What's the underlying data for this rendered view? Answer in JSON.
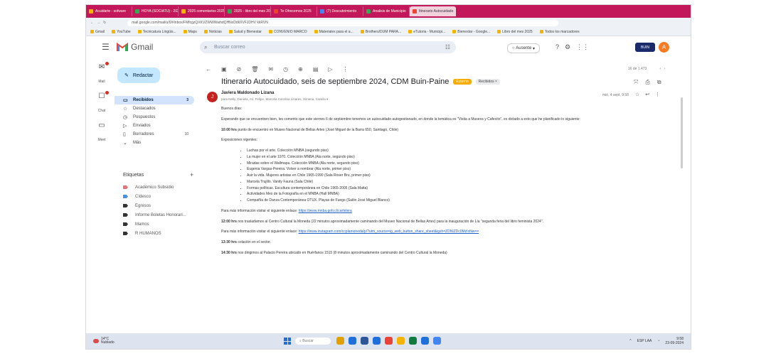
{
  "browser": {
    "tabs": [
      {
        "label": "Acuidarte - sofware",
        "color": "#f5b400"
      },
      {
        "label": "HOYA (SOCIATU) - 202",
        "color": "#34a853"
      },
      {
        "label": "2025 comentarios 2025",
        "color": "#f5b400"
      },
      {
        "label": "2025 - libro del mes 202",
        "color": "#34a853"
      },
      {
        "label": "Te Ofrecemos 2025",
        "color": "#ea4335"
      },
      {
        "label": "(7) Descubrimiento",
        "color": "#4285f4"
      },
      {
        "label": "Analisis de Municipio",
        "color": "#34a853"
      },
      {
        "label": "Itinerario Autocuidado",
        "color": "#ea4335",
        "active": true
      }
    ],
    "url": "mail.google.com/mail/u/0/#inbox/FMfcgzQXKVZWWWwhdQHNxDdkXVFJDHV kkRVN",
    "bookmarks": [
      "Gmail",
      "YouTube",
      "Tecnicatura Lingüis...",
      "Maps",
      "Noticias",
      "Salud y Bienestar",
      "CONVENIO MARCO",
      "Materiales para el a...",
      "Brothers/DUM PARA...",
      "eTutoria - Municipi...",
      "Bienestar - Google...",
      "Libro del mes 2025",
      "Todos los marcadores"
    ]
  },
  "gmail": {
    "app_name": "Gmail",
    "search_placeholder": "Buscar correo",
    "status": "Ausente",
    "account_label": "BUIN",
    "avatar_letter": "A",
    "compose_label": "Redactar",
    "rail": [
      "Mail",
      "Chat",
      "Meet"
    ],
    "folders": [
      {
        "label": "Recibidos",
        "icon": "inbox-icon",
        "count": "3",
        "selected": true
      },
      {
        "label": "Destacados",
        "icon": "star-icon"
      },
      {
        "label": "Pospuestos",
        "icon": "clock-icon"
      },
      {
        "label": "Enviados",
        "icon": "send-icon"
      },
      {
        "label": "Borradores",
        "icon": "draft-icon",
        "count": "10"
      },
      {
        "label": "Más",
        "icon": "chevron-down-icon"
      }
    ],
    "labels_header": "Etiquetas",
    "labels": [
      {
        "label": "Académico Subsidio",
        "color": "#e57373"
      },
      {
        "label": "Cídesco",
        "color": "#4a90e2"
      },
      {
        "label": "Egresos",
        "color": "#333333"
      },
      {
        "label": "Informe Boletas Honorari...",
        "color": "#333333"
      },
      {
        "label": "Mamos",
        "color": "#333333"
      },
      {
        "label": "R HUMANOS",
        "color": "#333333"
      }
    ],
    "pager": "16 de 1.473",
    "subject": "Itinerario Autocuidado, seis de septiembre 2024, CDM Buin-Paine",
    "badges": [
      {
        "label": "Externo",
        "bg": "#f9ab00",
        "fg": "#ffffff"
      },
      {
        "label": "Recibidos ×",
        "bg": "#e8eaed",
        "fg": "#444444"
      }
    ],
    "sender_initial": "J",
    "sender": "Javiera Maldonado Lizana",
    "to": "para Nelly, Daniela, mí, Felipe, Marcela Carolina Linares, Ximena, Camila ▾",
    "date": "mié, 4 sept, 9:58",
    "body": {
      "greeting": "Buenos días:",
      "intro": "Esperando que se encuentren bien, les comento que este viernes 6 de septiembre tenemos un autocuidado autogestionado, en donde la temática es \"Visita a Museos y Cafecito\", es dictado a esto que he planificado lo siguiente:",
      "meet_time": "10:00 hrs",
      "meet_text": " punto de encuentro en Museo Nacional de Bellas Artes (José Miguel de la Barra 650, Santiago, Chile)",
      "exhibits_header": "Exposiciones vigentes:",
      "exhibits": [
        "Luchas por el arte. Colección MNBA (segundo piso)",
        "La mujer en el arte 1970. Colección MNBA (Ala norte, segundo piso)",
        "Miradas sobre el Wallmapu. Colección MNBA (Ala norte, segundo piso)",
        "Eugenia Vargas-Pereira. Volver a nombrar (Ala norte, primer piso)",
        "Asir la vida. Mujeres artistas en Chile 1965-1990 (Sala Roser Bru, primer piso)",
        "Marcela Trujillo. Vanity Fauna (Sala Chile)",
        "Formas políticas. Escultura contemporánea en Chile 1965-2005 (Sala Matta)",
        "Actividades Mes de la Fotografía en el MNBA (Hall MNBA)",
        "Compañía de Danza Contemporánea OTUX. Playas de Fuego (Salón José Miguel Blanco)"
      ],
      "more_info_1": "Para más información visitar el siguiente enlace: ",
      "link_1": "https://www.mnba.gob.cl/cartelera",
      "t2_time": "12:00 hrs",
      "t2_text": " nos trasladamos al Centro Cultural la Moneda (22 minutos aproximadamente caminando del Museo Nacional de Bellas Artes) para la inauguración de Lía \"segunda feria del libro feminista 2024\".",
      "more_info_2": "Para más información visitar el siguiente enlace: ",
      "link_2": "https://www.instagram.com/ccplamoneda/p/?utm_source=ig_web_button_share_sheet&igsh=ZDNlZDc0MzIxNw==",
      "t3_time": "13:30 hrs",
      "t3_text": " colación en el sector.",
      "t4_time": "14:30 hrs",
      "t4_text": " nos dirigimos al Palacio Pereira ubicado en Huérfanos 1515 (8 minutos aproximadamente caminando del Centro Cultural la Moneda)"
    }
  },
  "taskbar": {
    "weather_temp": "14°C",
    "weather_desc": "Nublado",
    "search_label": "Buscar",
    "lang": "ESP LAA",
    "time": "9:58",
    "date": "23-09-2024",
    "app_colors": [
      "#e0a000",
      "#1e6fd9",
      "#2b579a",
      "#1e6fd9",
      "#ea4335",
      "#f5b400",
      "#0f7b3f",
      "#1e6fd9",
      "#4285f4"
    ]
  }
}
